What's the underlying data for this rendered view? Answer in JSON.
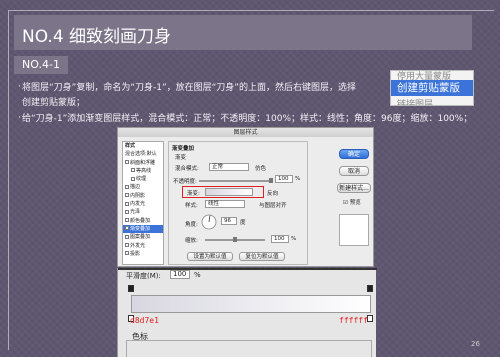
{
  "slide": {
    "title": "NO.4  细致刻画刀身",
    "section": "NO.4-1",
    "lines": [
      "将图层“刀身”复制，命名为“刀身-1”，放在图层“刀身”的上面，然后右键图层，选择",
      "创建剪贴蒙版；",
      "给“刀身-1”添加渐变图层样式，混合模式：正常；不透明度：100%；样式：线性；角度：96度；缩放：100%；"
    ],
    "page_number": "26"
  },
  "context_menu": {
    "items": [
      "停用大量蒙版",
      "创建剪贴蒙版",
      "链接图层"
    ],
    "selected_index": 1
  },
  "dialog": {
    "title": "图层样式",
    "styles_list": [
      "样式",
      "混合选项:默认",
      "斜面和浮雕",
      "等高线",
      "纹理",
      "描边",
      "内阴影",
      "内发光",
      "光泽",
      "颜色叠加",
      "渐变叠加",
      "图案叠加",
      "外发光",
      "投影"
    ],
    "active_style_index": 10,
    "panel": {
      "section_title": "渐变叠加",
      "subsection": "渐变",
      "blend_mode_label": "混合模式:",
      "blend_mode_value": "正常",
      "dither_label": "仿色",
      "opacity_label": "不透明度:",
      "opacity_value": "100",
      "opacity_unit": "%",
      "gradient_label": "渐变:",
      "reverse_label": "反向",
      "style_label": "样式:",
      "style_value": "线性",
      "align_label": "与图层对齐",
      "angle_label": "角度:",
      "angle_value": "96",
      "angle_unit": "度",
      "scale_label": "缩放:",
      "scale_value": "100",
      "scale_unit": "%",
      "set_default_label": "设置为默认值",
      "reset_default_label": "复位为默认值"
    },
    "buttons": {
      "ok": "确定",
      "cancel": "取消",
      "new_style": "新建样式...",
      "preview": "预览"
    }
  },
  "gradient_editor": {
    "smoothness_label": "平滑度(M):",
    "smoothness_value": "100",
    "smoothness_unit": "%",
    "stop_left_color": "d8d7e1",
    "stop_right_color": "ffffff",
    "group_label": "色标"
  },
  "colors": {
    "background": "#5f5670",
    "title_bar": "#7c7488",
    "highlight_red": "#e02020",
    "menu_selected": "#3b73d8",
    "gradient_start": "#d8d7e1",
    "gradient_end": "#ffffff"
  }
}
